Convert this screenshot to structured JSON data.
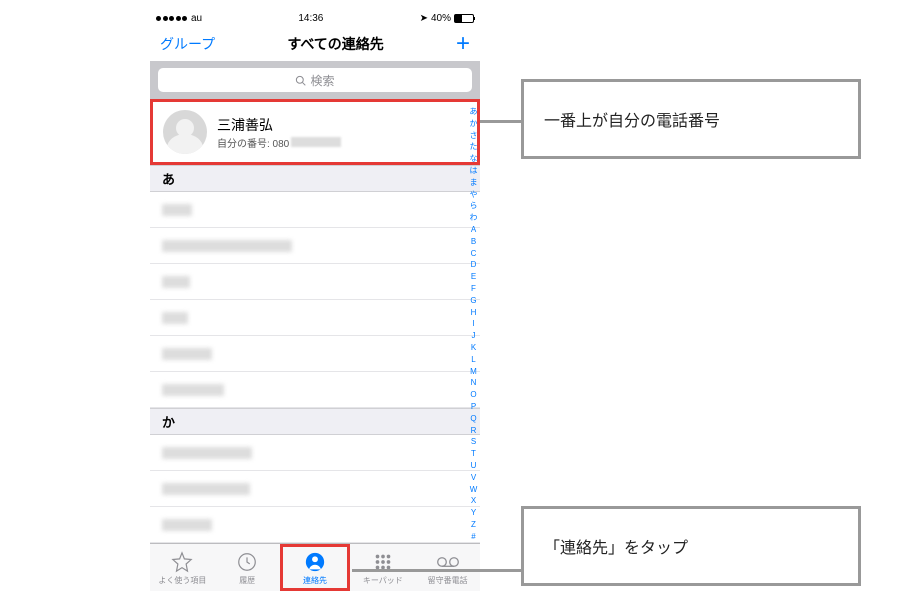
{
  "status": {
    "carrier": "au",
    "time": "14:36",
    "battery_pct": "40%"
  },
  "nav": {
    "left": "グループ",
    "title": "すべての連絡先",
    "plus": "+"
  },
  "search": {
    "placeholder": "検索"
  },
  "my_card": {
    "name": "三浦善弘",
    "number_label": "自分の番号: 080"
  },
  "sections": {
    "a": "あ",
    "ka": "か"
  },
  "index": [
    "あ",
    "か",
    "さ",
    "た",
    "な",
    "は",
    "ま",
    "や",
    "ら",
    "わ",
    "A",
    "B",
    "C",
    "D",
    "E",
    "F",
    "G",
    "H",
    "I",
    "J",
    "K",
    "L",
    "M",
    "N",
    "O",
    "P",
    "Q",
    "R",
    "S",
    "T",
    "U",
    "V",
    "W",
    "X",
    "Y",
    "Z",
    "#"
  ],
  "tabs": {
    "favorites": "よく使う項目",
    "recents": "履歴",
    "contacts": "連絡先",
    "keypad": "キーパッド",
    "voicemail": "留守番電話"
  },
  "callouts": {
    "top": "一番上が自分の電話番号",
    "bottom": "「連絡先」をタップ"
  }
}
